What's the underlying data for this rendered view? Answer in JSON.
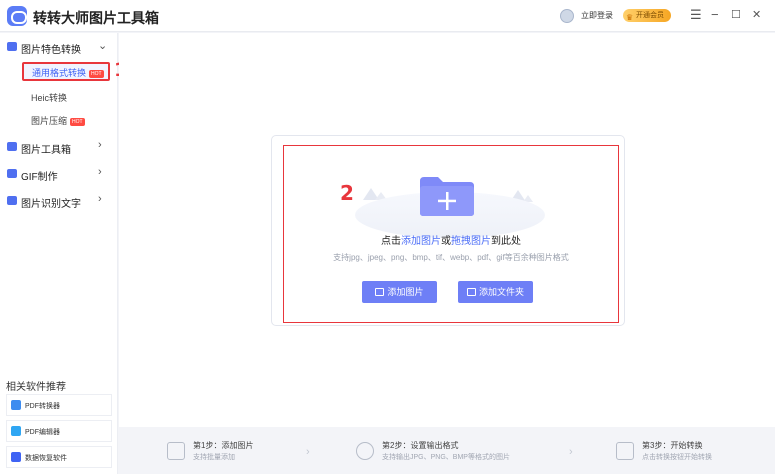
{
  "app": {
    "title": "转转大师图片工具箱"
  },
  "header": {
    "login": "立即登录",
    "vip": "开通会员",
    "controls": [
      "☰",
      "−",
      "☐",
      "✕"
    ]
  },
  "sidebar": {
    "groups": [
      {
        "label": "图片特色转换",
        "chevron": "⌄"
      },
      {
        "label": "图片工具箱",
        "chevron": "›"
      },
      {
        "label": "GIF制作",
        "chevron": "›"
      },
      {
        "label": "图片识别文字",
        "chevron": "›"
      }
    ],
    "sub_items": [
      {
        "label": "通用格式转换",
        "badge": "HOT"
      },
      {
        "label": "Heic转换",
        "badge": ""
      },
      {
        "label": "图片压缩",
        "badge": "HOT"
      }
    ],
    "related_title": "相关软件推荐",
    "related": [
      {
        "label": "PDF转换器",
        "color": "#3d8cf0"
      },
      {
        "label": "PDF编辑器",
        "color": "#2fa6f3"
      },
      {
        "label": "数据恢复软件",
        "color": "#3f63f4"
      }
    ]
  },
  "annotations": {
    "one": "1",
    "two": "2"
  },
  "drop": {
    "prompt_pre": "点击",
    "prompt_link1": "添加图片",
    "prompt_mid": "或",
    "prompt_link2": "拖拽图片",
    "prompt_post": "到此处",
    "formats": "支持jpg、jpeg、png、bmp、tif、webp、pdf、gif等百余种图片格式",
    "add_image": "添加图片",
    "add_folder": "添加文件夹"
  },
  "steps": [
    {
      "title": "第1步：添加图片",
      "desc": "支持批量添加"
    },
    {
      "title": "第2步：设置输出格式",
      "desc": "支持输出JPG、PNG、BMP等格式的图片"
    },
    {
      "title": "第3步：开始转换",
      "desc": "点击转换按钮开始转换"
    }
  ],
  "colors": {
    "accent": "#4a6cf7",
    "button": "#6e7ff6",
    "annotation": "#e8363c"
  }
}
